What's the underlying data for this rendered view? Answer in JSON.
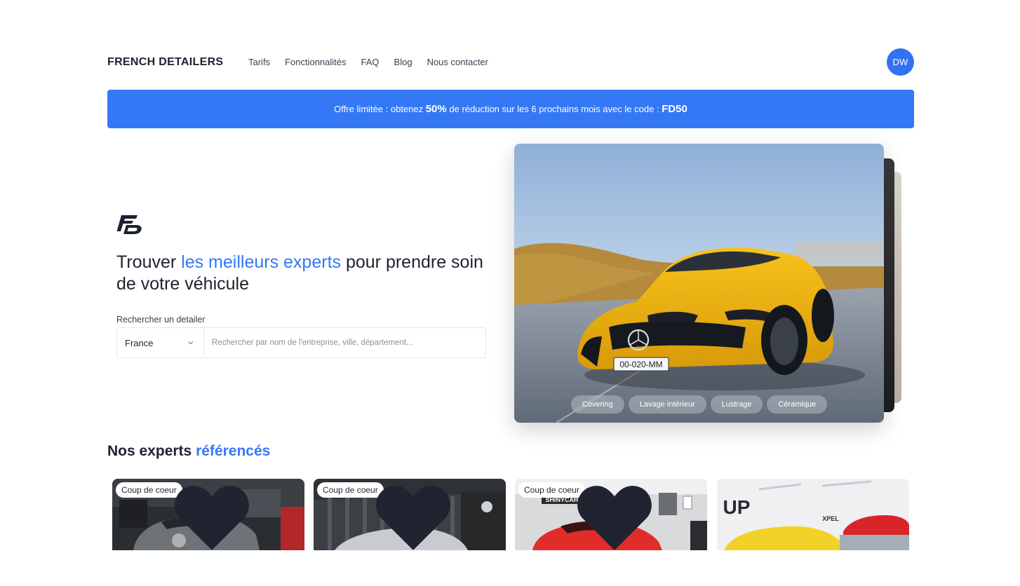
{
  "header": {
    "brand": "FRENCH DETAILERS",
    "nav": [
      "Tarifs",
      "Fonctionnalités",
      "FAQ",
      "Blog",
      "Nous contacter"
    ],
    "avatar_initials": "DW"
  },
  "promo": {
    "text_before": "Offre limitée : obtenez ",
    "discount": "50%",
    "text_middle": " de réduction sur les 6 prochains mois avec le code : ",
    "code": "FD50"
  },
  "hero": {
    "title_start": "Trouver ",
    "title_accent": "les meilleurs experts",
    "title_end": " pour prendre soin de votre véhicule",
    "search_label": "Rechercher un detailer",
    "country_selected": "France",
    "search_placeholder": "Rechercher par nom de l'entreprise, ville, département...",
    "car_plate": "00-020-MM",
    "chips": [
      "Covering",
      "Lavage intérieur",
      "Lustrage",
      "Céramique"
    ]
  },
  "experts": {
    "title_start": "Nos experts ",
    "title_accent": "référencés",
    "cards": [
      {
        "badge": "Coup de coeur"
      },
      {
        "badge": "Coup de coeur"
      },
      {
        "badge": "Coup de coeur",
        "sign": "SHINYCARS"
      },
      {
        "badge": "",
        "sign": "UP",
        "sign_small": "XPEL"
      }
    ]
  },
  "colors": {
    "accent": "#3478f6",
    "avatar": "#3272f0",
    "text_dark": "#1c2230"
  }
}
